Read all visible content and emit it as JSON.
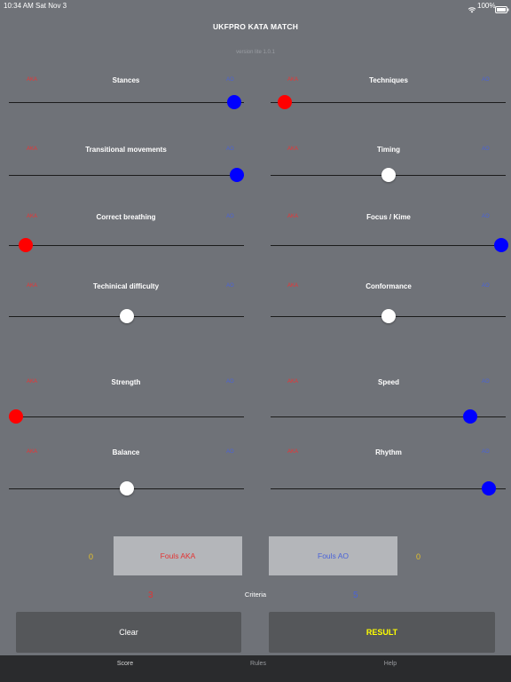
{
  "status_bar": {
    "time": "10:34 AM",
    "date": "Sat Nov 3",
    "battery": "100%",
    "wifi_icon": "wifi-icon",
    "battery_icon": "battery-icon"
  },
  "header": {
    "title": "UKFPRO KATA MATCH",
    "version": "version lite 1.0.1"
  },
  "side_labels": {
    "aka": "AKA",
    "ao": "AO"
  },
  "colors": {
    "aka": "#ff0000",
    "ao": "#0000ff",
    "neutral": "#ffffff",
    "aka_text": "#e33333",
    "ao_text": "#4a63d8",
    "count_text": "#e6c229",
    "result_text": "#ffff00"
  },
  "criteria": [
    {
      "label": "Stances",
      "value": 0.96,
      "side": "ao"
    },
    {
      "label": "Techniques",
      "value": 0.06,
      "side": "aka"
    },
    {
      "label": "Transitional movements",
      "value": 0.97,
      "side": "ao"
    },
    {
      "label": "Timing",
      "value": 0.5,
      "side": "neutral"
    },
    {
      "label": "Correct breathing",
      "value": 0.07,
      "side": "aka"
    },
    {
      "label": "Focus / Kime",
      "value": 0.98,
      "side": "ao"
    },
    {
      "label": "Techinical difficulty",
      "value": 0.5,
      "side": "neutral"
    },
    {
      "label": "Conformance",
      "value": 0.5,
      "side": "neutral"
    },
    {
      "label": "Strength",
      "value": 0.03,
      "side": "aka"
    },
    {
      "label": "Speed",
      "value": 0.85,
      "side": "ao"
    },
    {
      "label": "Balance",
      "value": 0.5,
      "side": "neutral"
    },
    {
      "label": "Rhythm",
      "value": 0.93,
      "side": "ao"
    }
  ],
  "fouls": {
    "aka_label": "Fouls AKA",
    "ao_label": "Fouls AO",
    "aka_count": "0",
    "ao_count": "0"
  },
  "score": {
    "label": "Criteria",
    "aka": "3",
    "ao": "5"
  },
  "actions": {
    "clear": "Clear",
    "result": "RESULT"
  },
  "tabs": [
    {
      "label": "Score",
      "active": true
    },
    {
      "label": "Rules",
      "active": false
    },
    {
      "label": "Help",
      "active": false
    }
  ]
}
